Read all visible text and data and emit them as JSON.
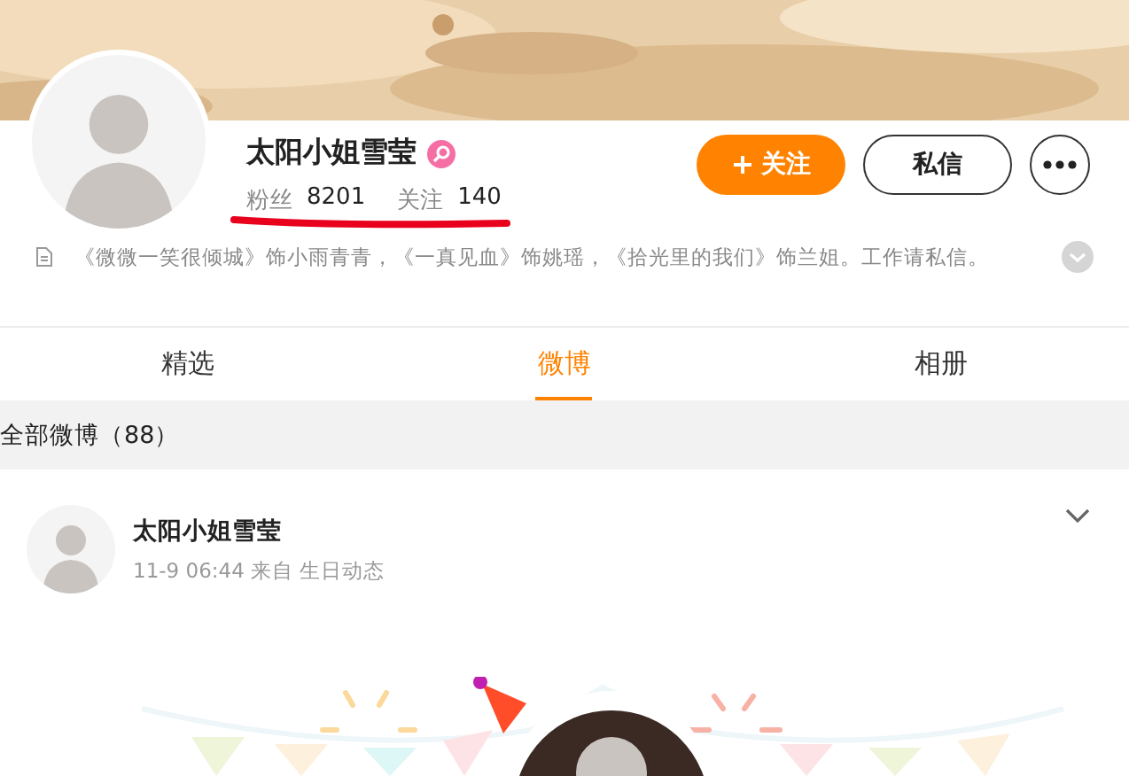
{
  "profile": {
    "name": "太阳小姐雪莹",
    "verified": true,
    "stats": [
      {
        "label": "粉丝",
        "value": "8201"
      },
      {
        "label": "关注",
        "value": "140"
      }
    ],
    "follow_button": "关注",
    "message_button": "私信",
    "bio": "《微微一笑很倾城》饰小雨青青，《一真见血》饰姚瑶，《拾光里的我们》饰兰姐。工作请私信。"
  },
  "tabs": [
    {
      "label": "精选",
      "selected": false
    },
    {
      "label": "微博",
      "selected": true
    },
    {
      "label": "相册",
      "selected": false
    }
  ],
  "feed_header": "全部微博（88）",
  "post": {
    "author": "太阳小姐雪莹",
    "meta": "11-9 06:44 来自 生日动态"
  }
}
